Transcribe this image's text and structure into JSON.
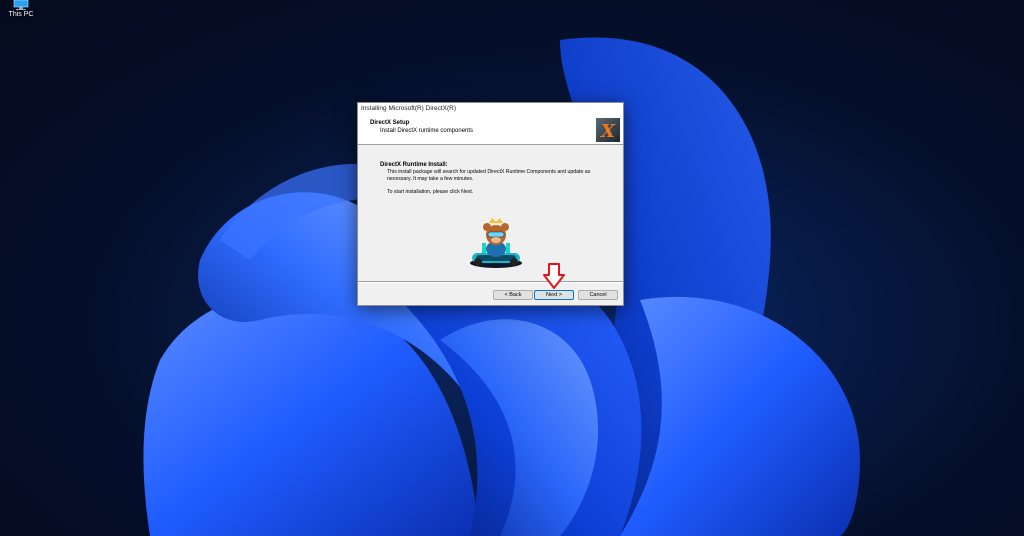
{
  "desktop": {
    "icons": [
      {
        "label": "This PC",
        "icon": "computer-icon"
      }
    ]
  },
  "dialog": {
    "window_title": "Installing Microsoft(R) DirectX(R)",
    "header": {
      "title": "DirectX Setup",
      "subtitle": "Install DirectX runtime components",
      "logo_icon": "directx-x-logo-icon",
      "logo_letter": "X"
    },
    "content": {
      "title": "DirectX Runtime Install:",
      "body": "This install package will search for updated DirectX Runtime Components and update as necessary. It may take a few minutes.",
      "start_hint": "To start installation, please click Next."
    },
    "buttons": {
      "back": "< Back",
      "next": "Next >",
      "cancel": "Cancel"
    },
    "annotation": {
      "icon": "red-down-arrow-icon",
      "color": "#e0161b"
    }
  },
  "colors": {
    "wallpaper_blue": "#1f5cff",
    "wallpaper_dark": "#050f2a",
    "dialog_bg": "#f0f0f0",
    "accent_next_border": "#0078d7"
  }
}
